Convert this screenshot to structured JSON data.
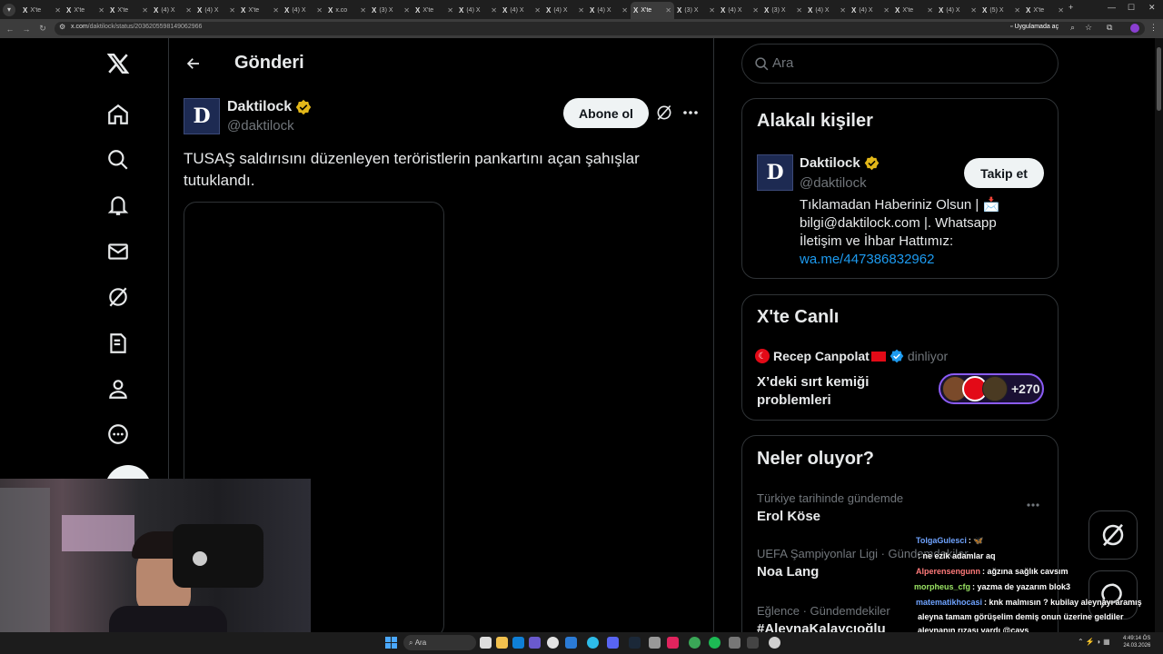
{
  "browser": {
    "tabs": [
      {
        "label": "X'te",
        "active": false
      },
      {
        "label": "X'te",
        "active": false
      },
      {
        "label": "X'te",
        "active": false
      },
      {
        "label": "(4) X",
        "active": false
      },
      {
        "label": "(4) X",
        "active": false
      },
      {
        "label": "X'te",
        "active": false
      },
      {
        "label": "(4) X",
        "active": false
      },
      {
        "label": "x.co",
        "active": false
      },
      {
        "label": "(3) X",
        "active": false
      },
      {
        "label": "X'te",
        "active": false
      },
      {
        "label": "(4) X",
        "active": false
      },
      {
        "label": "(4) X",
        "active": false
      },
      {
        "label": "(4) X",
        "active": false
      },
      {
        "label": "(4) X",
        "active": false
      },
      {
        "label": "X'te",
        "active": true
      },
      {
        "label": "(3) X",
        "active": false
      },
      {
        "label": "(4) X",
        "active": false
      },
      {
        "label": "(3) X",
        "active": false
      },
      {
        "label": "(4) X",
        "active": false
      },
      {
        "label": "(4) X",
        "active": false
      },
      {
        "label": "X'te",
        "active": false
      },
      {
        "label": "(4) X",
        "active": false
      },
      {
        "label": "(5) X",
        "active": false
      },
      {
        "label": "X'te",
        "active": false
      }
    ],
    "url_domain": "x.com",
    "url_path": "/daktilock/status/2036205598149062966",
    "app_button": "Uygulamada aç"
  },
  "header": {
    "title": "Gönderi"
  },
  "post": {
    "author_name": "Daktilock",
    "author_handle": "@daktilock",
    "subscribe_label": "Abone ol",
    "text_line1": "TUSAŞ saldırısını düzenleyen teröristlerin pankartını açan şahışlar",
    "text_line2": "tutuklandı."
  },
  "search": {
    "placeholder": "Ara"
  },
  "related": {
    "title": "Alakalı kişiler",
    "name": "Daktilock",
    "handle": "@daktilock",
    "follow_label": "Takip et",
    "bio_line1": "Tıklamadan Haberiniz Olsun | 📩",
    "bio_line2": "bilgi@daktilock.com |. Whatsapp",
    "bio_line3": "İletişim ve İhbar Hattımız:",
    "bio_link": "wa.me/447386832962"
  },
  "live": {
    "title": "X'te Canlı",
    "host": "Recep Canpolat",
    "status": "dinliyor",
    "topic_line1": "X’deki sırt kemiği",
    "topic_line2": "problemleri",
    "listeners": "+270"
  },
  "trends": {
    "title": "Neler oluyor?",
    "items": [
      {
        "context": "Türkiye tarihinde gündemde",
        "name": "Erol Köse"
      },
      {
        "context": "UEFA Şampiyonlar Ligi · Gündemdekiler",
        "name": "Noa Lang"
      },
      {
        "context": "Eğlence · Gündemdekiler",
        "name": "#AleynaKalaycıoğlu"
      }
    ]
  },
  "chat": {
    "lines": [
      {
        "user": "TolgaGulesci",
        "msg": ": 🦋",
        "color": "#6fa3ff"
      },
      {
        "user": "",
        "msg": ": ne ezik adamlar aq",
        "color": "#ff4d4d"
      },
      {
        "user": "Alperensengunn",
        "msg": ": ağzına sağlık cavsım",
        "color": "#ff7a7a"
      },
      {
        "user": "morpheus_cfg",
        "msg": ": yazma de yazarım blok3",
        "color": "#9be564"
      },
      {
        "user": "matematikhocasi",
        "msg": ": knk malmısın ? kubilay aleynayı aramış",
        "color": "#6fa3ff"
      },
      {
        "user": "",
        "msg": "aleyna tamam görüşelim demiş onun üzerine geldiler",
        "color": "#fff"
      },
      {
        "user": "",
        "msg": "aleynanın rızası vardı @cavs",
        "color": "#fff"
      }
    ]
  },
  "taskbar": {
    "search_label": "Ara",
    "time": "4:49:14 ÖS",
    "date": "24.03.2026"
  },
  "colors": {
    "accent": "#1d9bf0",
    "verified_gold": "#e2b719",
    "border": "#2f3336"
  }
}
